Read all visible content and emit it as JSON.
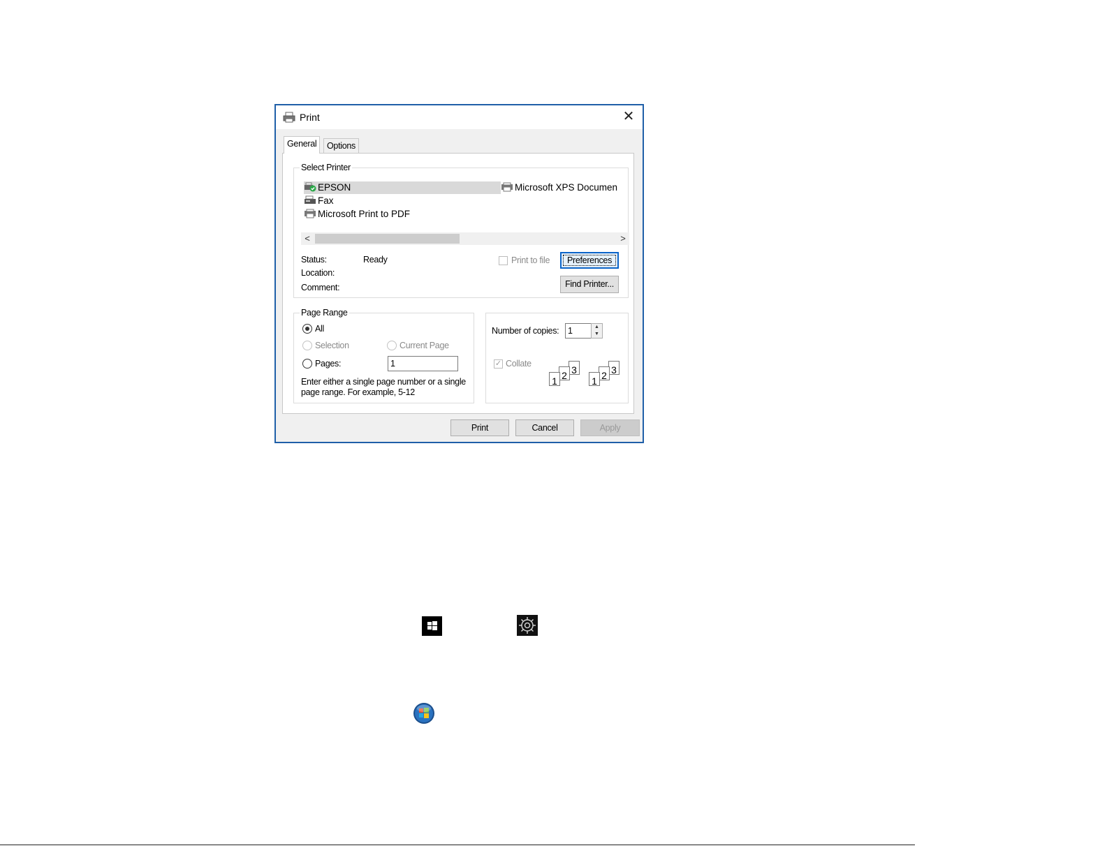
{
  "dialog": {
    "title": "Print",
    "close_glyph": "✕",
    "tabs": [
      {
        "label": "General"
      },
      {
        "label": "Options"
      }
    ],
    "select_printer": {
      "legend": "Select Printer",
      "printers": [
        {
          "label": "EPSON",
          "selected": true
        },
        {
          "label": "Fax"
        },
        {
          "label": "Microsoft Print to PDF"
        },
        {
          "label": "Microsoft XPS Documen"
        }
      ],
      "scroll_left": "<",
      "scroll_right": ">",
      "status_label": "Status:",
      "status_value": "Ready",
      "location_label": "Location:",
      "comment_label": "Comment:",
      "print_to_file": "Print to file",
      "preferences_button": "Preferences",
      "find_printer_button": "Find Printer..."
    },
    "page_range": {
      "legend": "Page Range",
      "all": "All",
      "selection": "Selection",
      "current_page": "Current Page",
      "pages": "Pages:",
      "pages_value": "1",
      "hint": "Enter either a single page number or a single page range.  For example, 5-12"
    },
    "copies": {
      "label": "Number of copies:",
      "value": "1",
      "collate": "Collate",
      "pages_set": [
        "1",
        "2",
        "3"
      ]
    },
    "buttons": {
      "print": "Print",
      "cancel": "Cancel",
      "apply": "Apply"
    }
  },
  "icons": {
    "windows_start": "windows-logo-icon",
    "settings": "gear-icon",
    "windows7_start": "windows7-orb-icon"
  },
  "colors": {
    "dialog_border": "#1f5fa8",
    "focus_blue": "#0a64c8",
    "selection_gray": "#d9d9d9"
  }
}
